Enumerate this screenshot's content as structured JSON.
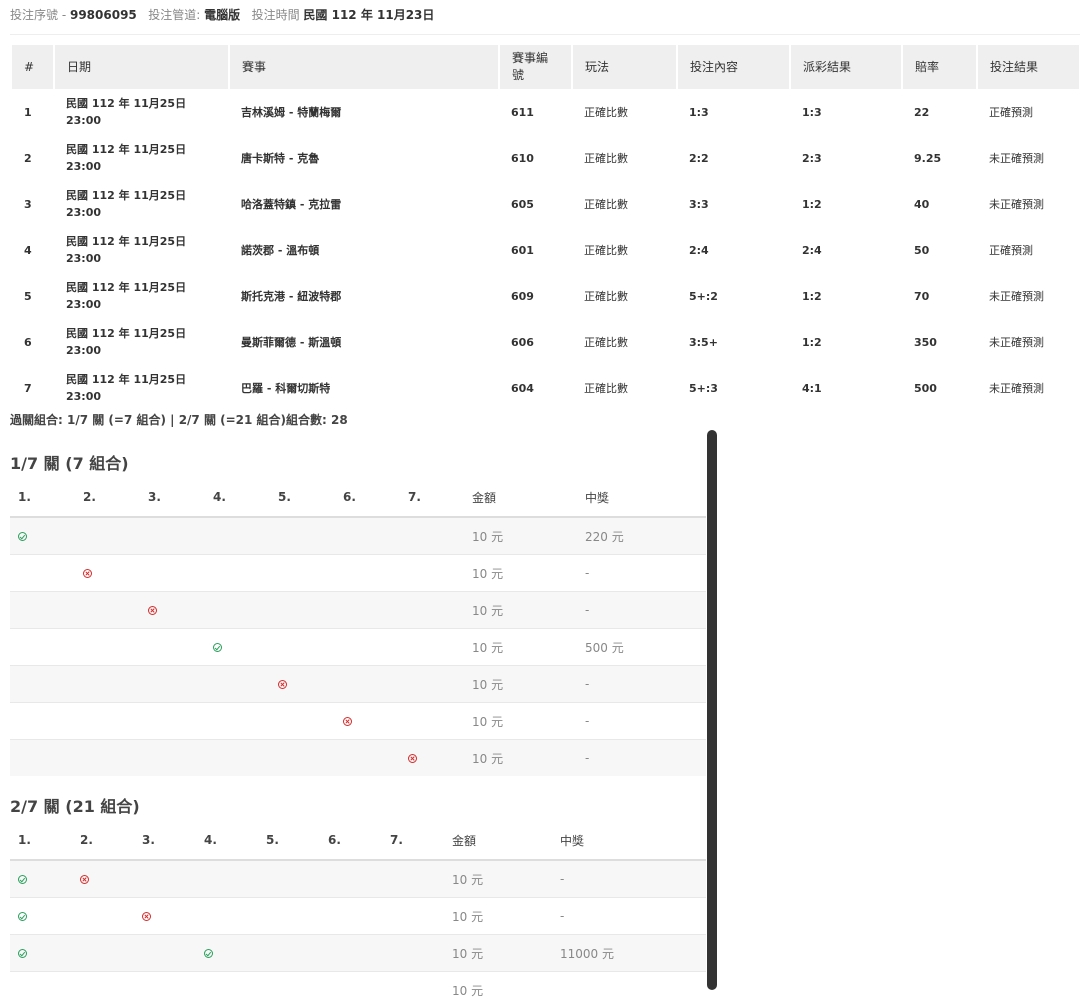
{
  "header": {
    "serial_label": "投注序號 -",
    "serial_value": "99806095",
    "channel_label": "投注管道:",
    "channel_value": "電腦版",
    "time_label": "投注時間",
    "time_value": "民國 112 年 11月23日"
  },
  "bets": {
    "columns": [
      "#",
      "日期",
      "賽事",
      "賽事編號",
      "玩法",
      "投注內容",
      "派彩結果",
      "賠率",
      "投注結果"
    ],
    "rows": [
      {
        "no": "1",
        "date": "民國 112 年 11月25日",
        "time": "23:00",
        "match": "吉林溪姆 - 特蘭梅爾",
        "match_id": "611",
        "play": "正確比數",
        "bet": "1:3",
        "payout": "1:3",
        "odds": "22",
        "result": "正確預測"
      },
      {
        "no": "2",
        "date": "民國 112 年 11月25日",
        "time": "23:00",
        "match": "唐卡斯特 - 克魯",
        "match_id": "610",
        "play": "正確比數",
        "bet": "2:2",
        "payout": "2:3",
        "odds": "9.25",
        "result": "未正確預測"
      },
      {
        "no": "3",
        "date": "民國 112 年 11月25日",
        "time": "23:00",
        "match": "哈洛蓋特鎮 - 克拉雷",
        "match_id": "605",
        "play": "正確比數",
        "bet": "3:3",
        "payout": "1:2",
        "odds": "40",
        "result": "未正確預測"
      },
      {
        "no": "4",
        "date": "民國 112 年 11月25日",
        "time": "23:00",
        "match": "諾茨郡 - 溫布頓",
        "match_id": "601",
        "play": "正確比數",
        "bet": "2:4",
        "payout": "2:4",
        "odds": "50",
        "result": "正確預測"
      },
      {
        "no": "5",
        "date": "民國 112 年 11月25日",
        "time": "23:00",
        "match": "斯托克港 - 紐波特郡",
        "match_id": "609",
        "play": "正確比數",
        "bet": "5+:2",
        "payout": "1:2",
        "odds": "70",
        "result": "未正確預測"
      },
      {
        "no": "6",
        "date": "民國 112 年 11月25日",
        "time": "23:00",
        "match": "曼斯菲爾德 - 斯溫頓",
        "match_id": "606",
        "play": "正確比數",
        "bet": "3:5+",
        "payout": "1:2",
        "odds": "350",
        "result": "未正確預測"
      },
      {
        "no": "7",
        "date": "民國 112 年 11月25日",
        "time": "23:00",
        "match": "巴羅 - 科爾切斯特",
        "match_id": "604",
        "play": "正確比數",
        "bet": "5+:3",
        "payout": "4:1",
        "odds": "500",
        "result": "未正確預測"
      }
    ]
  },
  "combo_summary": "過關組合: 1/7 關 (=7 組合) | 2/7 關 (=21 組合)組合數: 28",
  "combo_columns": [
    "1.",
    "2.",
    "3.",
    "4.",
    "5.",
    "6.",
    "7.",
    "金額",
    "中獎"
  ],
  "section1": {
    "title": "1/7 關 (7 組合)",
    "rows": [
      {
        "marks": [
          "ok",
          "",
          "",
          "",
          "",
          "",
          ""
        ],
        "amount": "10 元",
        "prize": "220 元"
      },
      {
        "marks": [
          "",
          "x",
          "",
          "",
          "",
          "",
          ""
        ],
        "amount": "10 元",
        "prize": "-"
      },
      {
        "marks": [
          "",
          "",
          "x",
          "",
          "",
          "",
          ""
        ],
        "amount": "10 元",
        "prize": "-"
      },
      {
        "marks": [
          "",
          "",
          "",
          "ok",
          "",
          "",
          ""
        ],
        "amount": "10 元",
        "prize": "500 元"
      },
      {
        "marks": [
          "",
          "",
          "",
          "",
          "x",
          "",
          ""
        ],
        "amount": "10 元",
        "prize": "-"
      },
      {
        "marks": [
          "",
          "",
          "",
          "",
          "",
          "x",
          ""
        ],
        "amount": "10 元",
        "prize": "-"
      },
      {
        "marks": [
          "",
          "",
          "",
          "",
          "",
          "",
          "x"
        ],
        "amount": "10 元",
        "prize": "-"
      }
    ]
  },
  "section2": {
    "title": "2/7 關 (21 組合)",
    "rows": [
      {
        "marks": [
          "ok",
          "x",
          "",
          "",
          "",
          "",
          ""
        ],
        "amount": "10 元",
        "prize": "-"
      },
      {
        "marks": [
          "ok",
          "",
          "x",
          "",
          "",
          "",
          ""
        ],
        "amount": "10 元",
        "prize": "-"
      },
      {
        "marks": [
          "ok",
          "",
          "",
          "ok",
          "",
          "",
          ""
        ],
        "amount": "10 元",
        "prize": "11000 元"
      },
      {
        "marks": [
          "",
          "",
          "",
          "",
          "",
          "",
          ""
        ],
        "amount": "10 元",
        "prize": ""
      }
    ]
  },
  "colors": {
    "ok": "#27a05a",
    "x": "#d62b2b",
    "header_bg": "#efefef",
    "scrollbar": "#333333"
  }
}
